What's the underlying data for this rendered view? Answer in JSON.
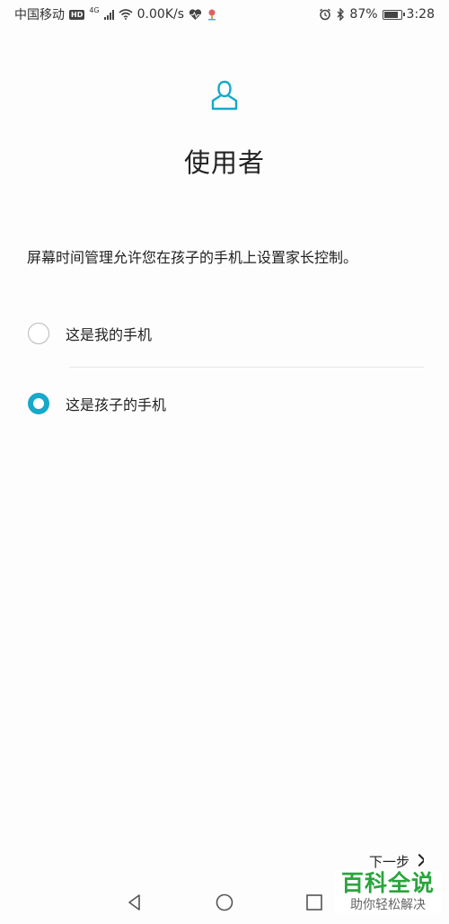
{
  "status_bar": {
    "carrier": "中国移动",
    "hd": "HD",
    "net_type": "4G",
    "speed": "0.00K/s",
    "battery_percent": "87%",
    "battery_level": 0.87,
    "time": "3:28"
  },
  "header": {
    "icon": "user-icon",
    "title": "使用者"
  },
  "description": "屏幕时间管理允许您在孩子的手机上设置家长控制。",
  "options": [
    {
      "label": "这是我的手机",
      "selected": false
    },
    {
      "label": "这是孩子的手机",
      "selected": true
    }
  ],
  "next_button": {
    "label": "下一步"
  },
  "nav": {
    "back": "back-triangle-icon",
    "home": "home-circle-icon",
    "recent": "recent-square-icon"
  },
  "watermark": {
    "main": "百科全说",
    "sub": "助你轻松解决"
  },
  "colors": {
    "accent": "#16a9c9",
    "watermark": "#2aa53c"
  }
}
